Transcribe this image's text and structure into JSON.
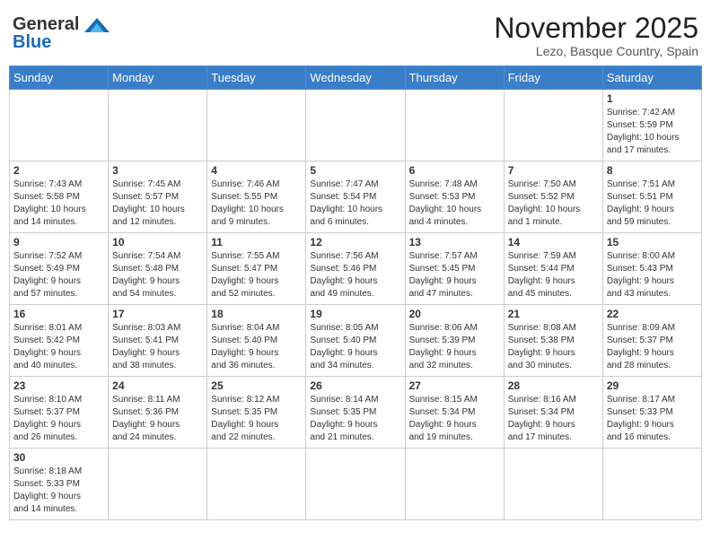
{
  "logo": {
    "general": "General",
    "blue": "Blue"
  },
  "title": "November 2025",
  "location": "Lezo, Basque Country, Spain",
  "days_of_week": [
    "Sunday",
    "Monday",
    "Tuesday",
    "Wednesday",
    "Thursday",
    "Friday",
    "Saturday"
  ],
  "weeks": [
    [
      {
        "day": "",
        "info": ""
      },
      {
        "day": "",
        "info": ""
      },
      {
        "day": "",
        "info": ""
      },
      {
        "day": "",
        "info": ""
      },
      {
        "day": "",
        "info": ""
      },
      {
        "day": "",
        "info": ""
      },
      {
        "day": "1",
        "info": "Sunrise: 7:42 AM\nSunset: 5:59 PM\nDaylight: 10 hours\nand 17 minutes."
      }
    ],
    [
      {
        "day": "2",
        "info": "Sunrise: 7:43 AM\nSunset: 5:58 PM\nDaylight: 10 hours\nand 14 minutes."
      },
      {
        "day": "3",
        "info": "Sunrise: 7:45 AM\nSunset: 5:57 PM\nDaylight: 10 hours\nand 12 minutes."
      },
      {
        "day": "4",
        "info": "Sunrise: 7:46 AM\nSunset: 5:55 PM\nDaylight: 10 hours\nand 9 minutes."
      },
      {
        "day": "5",
        "info": "Sunrise: 7:47 AM\nSunset: 5:54 PM\nDaylight: 10 hours\nand 6 minutes."
      },
      {
        "day": "6",
        "info": "Sunrise: 7:48 AM\nSunset: 5:53 PM\nDaylight: 10 hours\nand 4 minutes."
      },
      {
        "day": "7",
        "info": "Sunrise: 7:50 AM\nSunset: 5:52 PM\nDaylight: 10 hours\nand 1 minute."
      },
      {
        "day": "8",
        "info": "Sunrise: 7:51 AM\nSunset: 5:51 PM\nDaylight: 9 hours\nand 59 minutes."
      }
    ],
    [
      {
        "day": "9",
        "info": "Sunrise: 7:52 AM\nSunset: 5:49 PM\nDaylight: 9 hours\nand 57 minutes."
      },
      {
        "day": "10",
        "info": "Sunrise: 7:54 AM\nSunset: 5:48 PM\nDaylight: 9 hours\nand 54 minutes."
      },
      {
        "day": "11",
        "info": "Sunrise: 7:55 AM\nSunset: 5:47 PM\nDaylight: 9 hours\nand 52 minutes."
      },
      {
        "day": "12",
        "info": "Sunrise: 7:56 AM\nSunset: 5:46 PM\nDaylight: 9 hours\nand 49 minutes."
      },
      {
        "day": "13",
        "info": "Sunrise: 7:57 AM\nSunset: 5:45 PM\nDaylight: 9 hours\nand 47 minutes."
      },
      {
        "day": "14",
        "info": "Sunrise: 7:59 AM\nSunset: 5:44 PM\nDaylight: 9 hours\nand 45 minutes."
      },
      {
        "day": "15",
        "info": "Sunrise: 8:00 AM\nSunset: 5:43 PM\nDaylight: 9 hours\nand 43 minutes."
      }
    ],
    [
      {
        "day": "16",
        "info": "Sunrise: 8:01 AM\nSunset: 5:42 PM\nDaylight: 9 hours\nand 40 minutes."
      },
      {
        "day": "17",
        "info": "Sunrise: 8:03 AM\nSunset: 5:41 PM\nDaylight: 9 hours\nand 38 minutes."
      },
      {
        "day": "18",
        "info": "Sunrise: 8:04 AM\nSunset: 5:40 PM\nDaylight: 9 hours\nand 36 minutes."
      },
      {
        "day": "19",
        "info": "Sunrise: 8:05 AM\nSunset: 5:40 PM\nDaylight: 9 hours\nand 34 minutes."
      },
      {
        "day": "20",
        "info": "Sunrise: 8:06 AM\nSunset: 5:39 PM\nDaylight: 9 hours\nand 32 minutes."
      },
      {
        "day": "21",
        "info": "Sunrise: 8:08 AM\nSunset: 5:38 PM\nDaylight: 9 hours\nand 30 minutes."
      },
      {
        "day": "22",
        "info": "Sunrise: 8:09 AM\nSunset: 5:37 PM\nDaylight: 9 hours\nand 28 minutes."
      }
    ],
    [
      {
        "day": "23",
        "info": "Sunrise: 8:10 AM\nSunset: 5:37 PM\nDaylight: 9 hours\nand 26 minutes."
      },
      {
        "day": "24",
        "info": "Sunrise: 8:11 AM\nSunset: 5:36 PM\nDaylight: 9 hours\nand 24 minutes."
      },
      {
        "day": "25",
        "info": "Sunrise: 8:12 AM\nSunset: 5:35 PM\nDaylight: 9 hours\nand 22 minutes."
      },
      {
        "day": "26",
        "info": "Sunrise: 8:14 AM\nSunset: 5:35 PM\nDaylight: 9 hours\nand 21 minutes."
      },
      {
        "day": "27",
        "info": "Sunrise: 8:15 AM\nSunset: 5:34 PM\nDaylight: 9 hours\nand 19 minutes."
      },
      {
        "day": "28",
        "info": "Sunrise: 8:16 AM\nSunset: 5:34 PM\nDaylight: 9 hours\nand 17 minutes."
      },
      {
        "day": "29",
        "info": "Sunrise: 8:17 AM\nSunset: 5:33 PM\nDaylight: 9 hours\nand 16 minutes."
      }
    ],
    [
      {
        "day": "30",
        "info": "Sunrise: 8:18 AM\nSunset: 5:33 PM\nDaylight: 9 hours\nand 14 minutes."
      },
      {
        "day": "",
        "info": ""
      },
      {
        "day": "",
        "info": ""
      },
      {
        "day": "",
        "info": ""
      },
      {
        "day": "",
        "info": ""
      },
      {
        "day": "",
        "info": ""
      },
      {
        "day": "",
        "info": ""
      }
    ]
  ]
}
